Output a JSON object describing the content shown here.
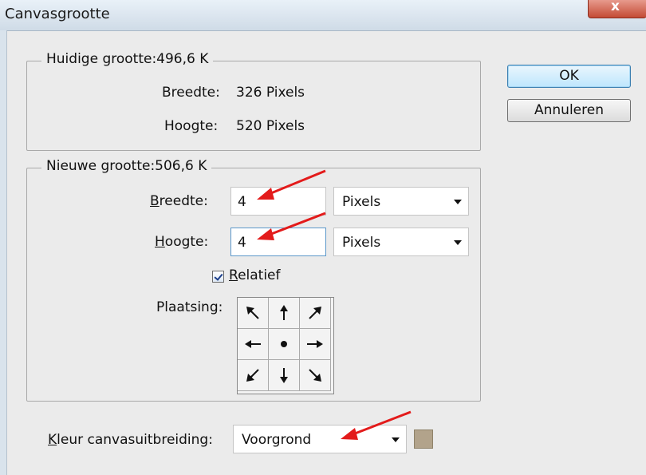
{
  "window": {
    "title": "Canvasgrootte"
  },
  "buttons": {
    "ok": "OK",
    "cancel": "Annuleren"
  },
  "current_size": {
    "legend": "Huidige grootte:496,6 K",
    "width_label": "Breedte:",
    "width_value": "326 Pixels",
    "height_label": "Hoogte:",
    "height_value": "520 Pixels"
  },
  "new_size": {
    "legend": "Nieuwe grootte:506,6 K",
    "width_label_first": "B",
    "width_label_rest": "reedte:",
    "width_value": "4",
    "width_unit": "Pixels",
    "height_label_first": "H",
    "height_label_rest": "oogte:",
    "height_value": "4",
    "height_unit": "Pixels",
    "relative_first": "R",
    "relative_rest": "elatief",
    "relative_checked": true,
    "anchor_label": "Plaatsing:"
  },
  "canvas_extension": {
    "label_first": "K",
    "label_rest": "leur canvasuitbreiding:",
    "value": "Voorgrond",
    "swatch_color": "#b2a38b"
  },
  "icons": {
    "anchor": [
      "arrow-up-left-icon",
      "arrow-up-icon",
      "arrow-up-right-icon",
      "arrow-left-icon",
      "dot-icon",
      "arrow-right-icon",
      "arrow-down-left-icon",
      "arrow-down-icon",
      "arrow-down-right-icon"
    ]
  },
  "annotation_color": "#e31b1b"
}
